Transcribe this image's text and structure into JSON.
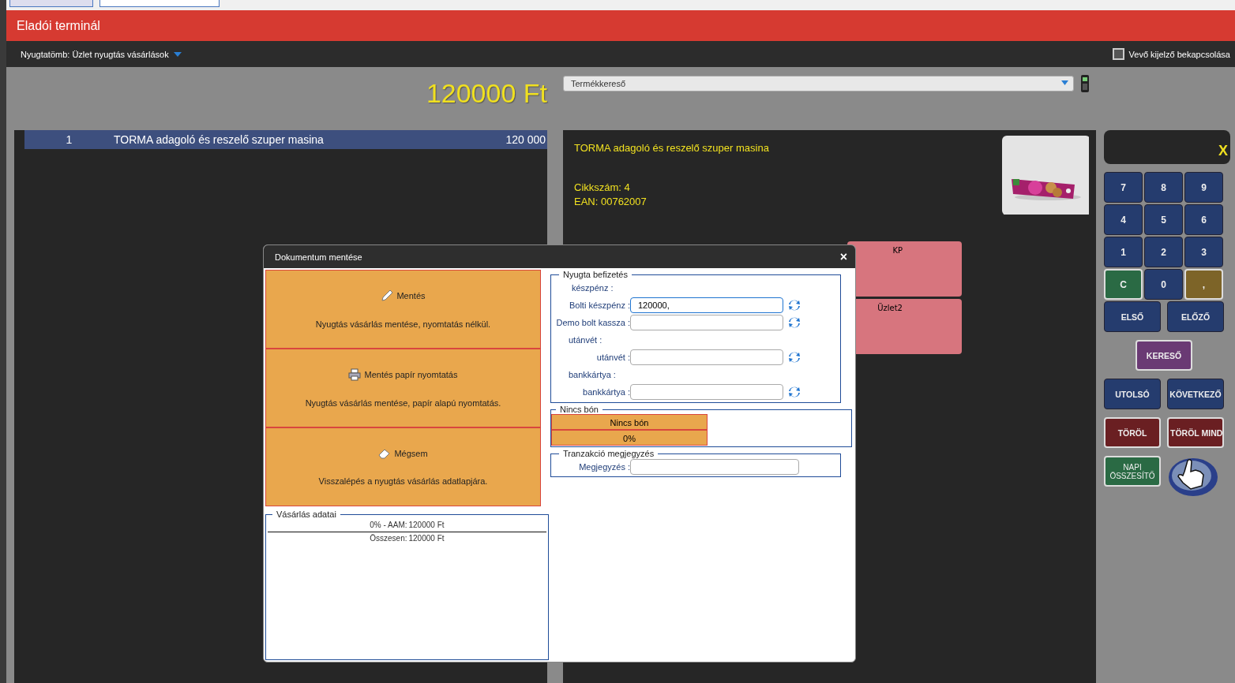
{
  "header": {
    "title": "Eladói terminál"
  },
  "toolbar": {
    "receipt_book": "Nyugtatömb: Üzlet nyugtás vásárlások",
    "customer_display": {
      "label": "Vevő kijelző bekapcsolása",
      "checked": false
    }
  },
  "total": "120000 Ft",
  "product_search": {
    "placeholder": "Termékkereső"
  },
  "cart_rows": [
    {
      "qty": "1",
      "name": "TORMA adagoló és reszelő szuper masina",
      "price": "120 000",
      "selected": true
    }
  ],
  "product": {
    "name": "TORMA adagoló és reszelő szuper masina",
    "sku": "Cikkszám: 4",
    "ean": "EAN: 00762007"
  },
  "payment_tiles": [
    "KP",
    "Üzlet2"
  ],
  "keypad": {
    "close": "X",
    "keys": [
      {
        "label": "7",
        "kind": "digit"
      },
      {
        "label": "8",
        "kind": "digit"
      },
      {
        "label": "9",
        "kind": "digit"
      },
      {
        "label": "4",
        "kind": "digit"
      },
      {
        "label": "5",
        "kind": "digit"
      },
      {
        "label": "6",
        "kind": "digit"
      },
      {
        "label": "1",
        "kind": "digit"
      },
      {
        "label": "2",
        "kind": "digit"
      },
      {
        "label": "3",
        "kind": "digit"
      },
      {
        "label": "C",
        "kind": "clear"
      },
      {
        "label": "0",
        "kind": "digit"
      },
      {
        "label": ",",
        "kind": "comma"
      }
    ],
    "actions": [
      {
        "label": "ELSŐ",
        "kind": "nav"
      },
      {
        "label": "ELŐZŐ",
        "kind": "nav"
      },
      {
        "label": "KERESŐ",
        "kind": "search"
      },
      {
        "label": "UTOLSÓ",
        "kind": "nav"
      },
      {
        "label": "KÖVETKEZŐ",
        "kind": "nav"
      },
      {
        "label": "TÖRÖL",
        "kind": "delete"
      },
      {
        "label": "TÖRÖL MIND",
        "kind": "delete"
      },
      {
        "label": "NAPI ÖSSZESÍTŐ",
        "kind": "summary"
      }
    ]
  },
  "dialog": {
    "title": "Dokumentum mentése",
    "close": "×",
    "actions": [
      {
        "kind": "pencil",
        "title": "Mentés",
        "description": "Nyugtás vásárlás mentése, nyomtatás nélkül."
      },
      {
        "kind": "printer",
        "title": "Mentés papír nyomtatás",
        "description": "Nyugtás vásárlás mentése, papír alapú nyomtatás."
      },
      {
        "kind": "eraser",
        "title": "Mégsem",
        "description": "Visszalépés a nyugtás vásárlás adatlapjára."
      }
    ],
    "purchase": {
      "legend": "Vásárlás adatai",
      "lines": [
        {
          "label": "0% - AAM:",
          "value": "120000 Ft"
        },
        {
          "label": "Összesen:",
          "value": "120000 Ft"
        }
      ]
    },
    "payment": {
      "legend": "Nyugta befizetés",
      "groups": [
        {
          "heading": "készpénz :",
          "fields": [
            {
              "label": "Bolti készpénz :",
              "value": "120000,",
              "focused": true
            },
            {
              "label": "Demo bolt kassza :",
              "focused": false
            }
          ]
        },
        {
          "heading": "utánvét :",
          "fields": [
            {
              "label": "utánvét :",
              "focused": false
            }
          ]
        },
        {
          "heading": "bankkártya :",
          "fields": [
            {
              "label": "bankkártya :",
              "focused": false
            }
          ]
        }
      ]
    },
    "voucher": {
      "legend": "Nincs bón",
      "name": "Nincs bón",
      "percent": "0%"
    },
    "note": {
      "legend": "Tranzakció megjegyzés",
      "label": "Megjegyzés :"
    }
  }
}
